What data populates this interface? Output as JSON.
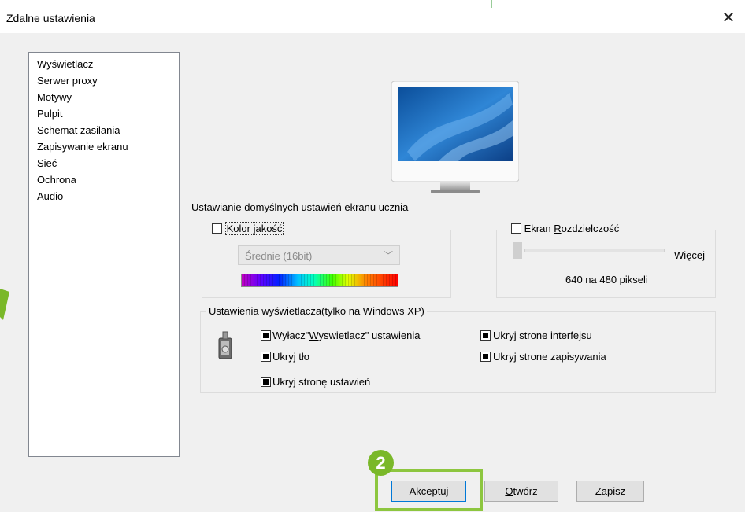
{
  "window": {
    "title": "Zdalne ustawienia",
    "close_label": "✕"
  },
  "sidebar": {
    "items": [
      {
        "label": "Wyświetlacz"
      },
      {
        "label": "Serwer proxy"
      },
      {
        "label": "Motywy"
      },
      {
        "label": "Pulpit"
      },
      {
        "label": "Schemat zasilania"
      },
      {
        "label": "Zapisywanie ekranu"
      },
      {
        "label": "Sieć"
      },
      {
        "label": "Ochrona"
      },
      {
        "label": "Audio"
      }
    ]
  },
  "display": {
    "section_label": "Ustawianie domyślnych ustawień ekranu ucznia",
    "color_quality": {
      "label": "Kolor jakość",
      "checked": false,
      "select_value": "Średnie (16bit)"
    },
    "resolution": {
      "label_prefix": "Ekran ",
      "label_accel": "R",
      "label_rest": "ozdzielczość",
      "checked": false,
      "more_label": "Więcej",
      "value_text": "640 na 480 pikseli",
      "slider_level": 0
    }
  },
  "xp": {
    "group_title": "Ustawienia wyświetlacza(tylko na Windows XP)",
    "options": {
      "disable_display": {
        "prefix": "Wyłacz\"",
        "accel": "W",
        "rest": "yswietlacz\" ustawienia",
        "checked": true
      },
      "hide_background": {
        "label": "Ukryj tło",
        "checked": true
      },
      "hide_settings_page": {
        "label": "Ukryj stronę ustawień",
        "checked": true
      },
      "hide_interface_page": {
        "label": "Ukryj strone interfejsu",
        "checked": true
      },
      "hide_save_page": {
        "label": "Ukryj strone zapisywania",
        "checked": true
      }
    }
  },
  "buttons": {
    "accept": "Akceptuj",
    "open_accel": "O",
    "open_rest": "twórz",
    "save": "Zapisz"
  },
  "annotation": {
    "step_number": "2"
  },
  "colors": {
    "highlight": "#8dc63f",
    "badge": "#7ab829",
    "dialog_bg": "#f0f0f0"
  }
}
